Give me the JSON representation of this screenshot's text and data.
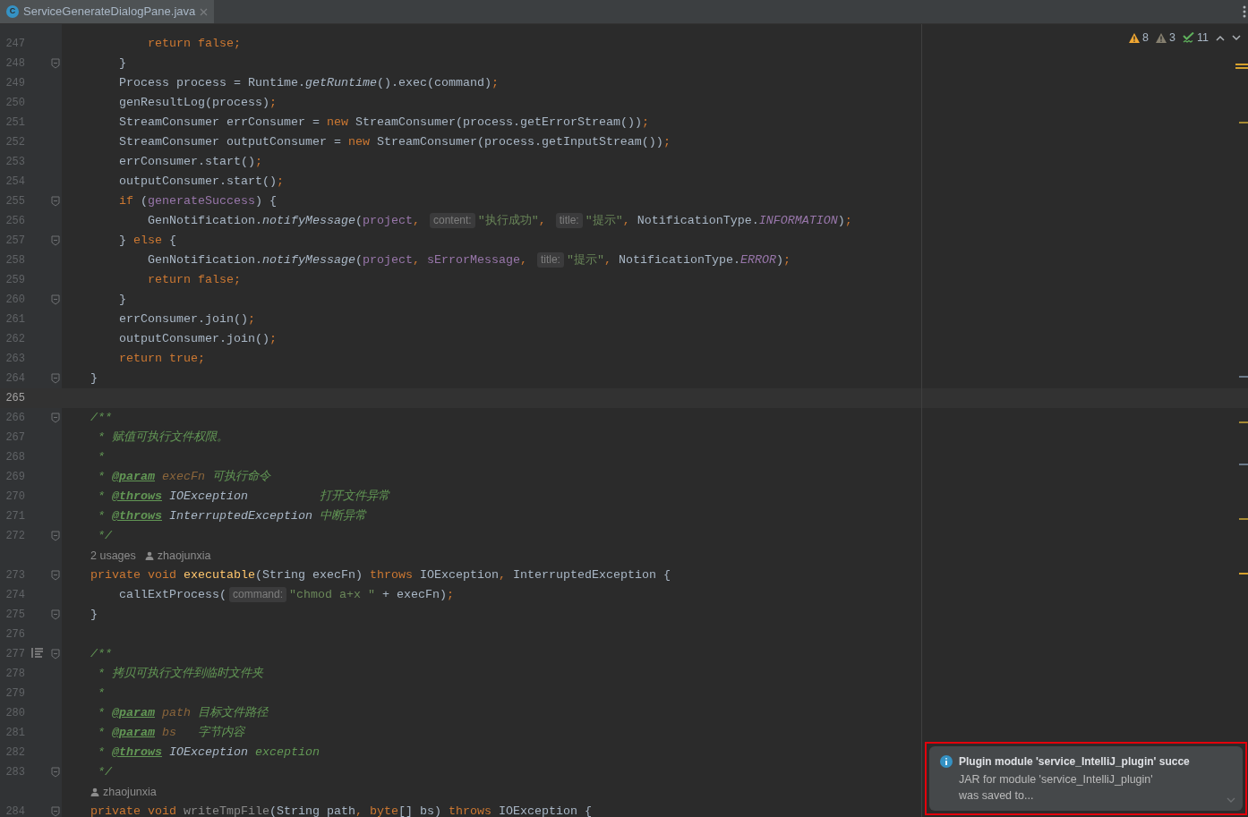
{
  "tab": {
    "title": "ServiceGenerateDialogPane.java",
    "icon": "C",
    "selected": true
  },
  "inspections": [
    {
      "kind": "warning",
      "count": "8"
    },
    {
      "kind": "weak_warning",
      "count": "3"
    },
    {
      "kind": "typo",
      "count": "11"
    }
  ],
  "rows": [
    {
      "kind": "code",
      "number": "247",
      "fold": false,
      "current": false,
      "tokens": [
        {
          "kind": "kw",
          "text": "        return false;"
        }
      ]
    },
    {
      "kind": "code",
      "number": "248",
      "fold": true,
      "current": false,
      "tokens": [
        {
          "kind": "plain",
          "text": "    }"
        }
      ]
    },
    {
      "kind": "code",
      "number": "249",
      "fold": false,
      "current": false,
      "tokens": [
        {
          "kind": "plain",
          "text": "    Process process = Runtime."
        },
        {
          "kind": "italic",
          "text": "getRuntime"
        },
        {
          "kind": "plain",
          "text": "().exec(command)"
        },
        {
          "kind": "kw",
          "text": ";"
        }
      ]
    },
    {
      "kind": "code",
      "number": "250",
      "fold": false,
      "current": false,
      "tokens": [
        {
          "kind": "plain",
          "text": "    genResultLog(process)"
        },
        {
          "kind": "kw",
          "text": ";"
        }
      ]
    },
    {
      "kind": "code",
      "number": "251",
      "fold": false,
      "current": false,
      "tokens": [
        {
          "kind": "plain",
          "text": "    StreamConsumer errConsumer = "
        },
        {
          "kind": "kw",
          "text": "new"
        },
        {
          "kind": "plain",
          "text": " StreamConsumer(process.getErrorStream())"
        },
        {
          "kind": "kw",
          "text": ";"
        }
      ]
    },
    {
      "kind": "code",
      "number": "252",
      "fold": false,
      "current": false,
      "tokens": [
        {
          "kind": "plain",
          "text": "    StreamConsumer outputConsumer = "
        },
        {
          "kind": "kw",
          "text": "new"
        },
        {
          "kind": "plain",
          "text": " StreamConsumer(process.getInputStream())"
        },
        {
          "kind": "kw",
          "text": ";"
        }
      ]
    },
    {
      "kind": "code",
      "number": "253",
      "fold": false,
      "current": false,
      "tokens": [
        {
          "kind": "plain",
          "text": "    errConsumer.start()"
        },
        {
          "kind": "kw",
          "text": ";"
        }
      ]
    },
    {
      "kind": "code",
      "number": "254",
      "fold": false,
      "current": false,
      "tokens": [
        {
          "kind": "plain",
          "text": "    outputConsumer.start()"
        },
        {
          "kind": "kw",
          "text": ";"
        }
      ]
    },
    {
      "kind": "code",
      "number": "255",
      "fold": true,
      "current": false,
      "tokens": [
        {
          "kind": "kw",
          "text": "    if"
        },
        {
          "kind": "plain",
          "text": " ("
        },
        {
          "kind": "field",
          "text": "generateSuccess"
        },
        {
          "kind": "plain",
          "text": ") {"
        }
      ]
    },
    {
      "kind": "code",
      "number": "256",
      "fold": false,
      "current": false,
      "tokens": [
        {
          "kind": "plain",
          "text": "        GenNotification."
        },
        {
          "kind": "italic",
          "text": "notifyMessage"
        },
        {
          "kind": "plain",
          "text": "("
        },
        {
          "kind": "field",
          "text": "project"
        },
        {
          "kind": "kw",
          "text": ", "
        },
        {
          "kind": "hint",
          "text": "content:"
        },
        {
          "kind": "str",
          "text": "\"执行成功\""
        },
        {
          "kind": "kw",
          "text": ", "
        },
        {
          "kind": "hint",
          "text": "title:"
        },
        {
          "kind": "str",
          "text": "\"提示\""
        },
        {
          "kind": "kw",
          "text": ", "
        },
        {
          "kind": "plain",
          "text": "NotificationType."
        },
        {
          "kind": "field_italic",
          "text": "INFORMATION"
        },
        {
          "kind": "plain",
          "text": ")"
        },
        {
          "kind": "kw",
          "text": ";"
        }
      ]
    },
    {
      "kind": "code",
      "number": "257",
      "fold": true,
      "current": false,
      "tokens": [
        {
          "kind": "plain",
          "text": "    } "
        },
        {
          "kind": "kw",
          "text": "else"
        },
        {
          "kind": "plain",
          "text": " {"
        }
      ]
    },
    {
      "kind": "code",
      "number": "258",
      "fold": false,
      "current": false,
      "tokens": [
        {
          "kind": "plain",
          "text": "        GenNotification."
        },
        {
          "kind": "italic",
          "text": "notifyMessage"
        },
        {
          "kind": "plain",
          "text": "("
        },
        {
          "kind": "field",
          "text": "project"
        },
        {
          "kind": "kw",
          "text": ", "
        },
        {
          "kind": "field",
          "text": "sErrorMessage"
        },
        {
          "kind": "kw",
          "text": ", "
        },
        {
          "kind": "hint",
          "text": "title:"
        },
        {
          "kind": "str",
          "text": "\"提示\""
        },
        {
          "kind": "kw",
          "text": ", "
        },
        {
          "kind": "plain",
          "text": "NotificationType."
        },
        {
          "kind": "field_italic",
          "text": "ERROR"
        },
        {
          "kind": "plain",
          "text": ")"
        },
        {
          "kind": "kw",
          "text": ";"
        }
      ]
    },
    {
      "kind": "code",
      "number": "259",
      "fold": false,
      "current": false,
      "tokens": [
        {
          "kind": "kw",
          "text": "        return false;"
        }
      ]
    },
    {
      "kind": "code",
      "number": "260",
      "fold": true,
      "current": false,
      "tokens": [
        {
          "kind": "plain",
          "text": "    }"
        }
      ]
    },
    {
      "kind": "code",
      "number": "261",
      "fold": false,
      "current": false,
      "tokens": [
        {
          "kind": "plain",
          "text": "    errConsumer.join()"
        },
        {
          "kind": "kw",
          "text": ";"
        }
      ]
    },
    {
      "kind": "code",
      "number": "262",
      "fold": false,
      "current": false,
      "tokens": [
        {
          "kind": "plain",
          "text": "    outputConsumer.join()"
        },
        {
          "kind": "kw",
          "text": ";"
        }
      ]
    },
    {
      "kind": "code",
      "number": "263",
      "fold": false,
      "current": false,
      "tokens": [
        {
          "kind": "kw",
          "text": "    return true;"
        }
      ]
    },
    {
      "kind": "code",
      "number": "264",
      "fold": true,
      "current": false,
      "tokens": [
        {
          "kind": "plain",
          "text": "}"
        }
      ]
    },
    {
      "kind": "code",
      "number": "265",
      "fold": false,
      "current": true,
      "tokens": []
    },
    {
      "kind": "code",
      "number": "266",
      "fold": true,
      "current": false,
      "tokens": [
        {
          "kind": "doc",
          "text": "/**"
        }
      ]
    },
    {
      "kind": "code",
      "number": "267",
      "fold": false,
      "current": false,
      "tokens": [
        {
          "kind": "doc",
          "text": " * 赋值可执行文件权限。"
        }
      ]
    },
    {
      "kind": "code",
      "number": "268",
      "fold": false,
      "current": false,
      "tokens": [
        {
          "kind": "doc",
          "text": " *"
        }
      ]
    },
    {
      "kind": "code",
      "number": "269",
      "fold": false,
      "current": false,
      "tokens": [
        {
          "kind": "doc",
          "text": " * "
        },
        {
          "kind": "doctag",
          "text": "@param"
        },
        {
          "kind": "docparam",
          "text": " execFn"
        },
        {
          "kind": "doc",
          "text": " 可执行命令"
        }
      ]
    },
    {
      "kind": "code",
      "number": "270",
      "fold": false,
      "current": false,
      "tokens": [
        {
          "kind": "doc",
          "text": " * "
        },
        {
          "kind": "doctag",
          "text": "@throws"
        },
        {
          "kind": "docref",
          "text": " IOException"
        },
        {
          "kind": "doc",
          "text": "          打开文件异常"
        }
      ]
    },
    {
      "kind": "code",
      "number": "271",
      "fold": false,
      "current": false,
      "tokens": [
        {
          "kind": "doc",
          "text": " * "
        },
        {
          "kind": "doctag",
          "text": "@throws"
        },
        {
          "kind": "docref",
          "text": " InterruptedException"
        },
        {
          "kind": "doc",
          "text": " 中断异常"
        }
      ]
    },
    {
      "kind": "code",
      "number": "272",
      "fold": true,
      "current": false,
      "tokens": [
        {
          "kind": "doc",
          "text": " */"
        }
      ]
    },
    {
      "kind": "lens",
      "items": [
        {
          "kind": "usages",
          "text": "2 usages"
        },
        {
          "kind": "author",
          "text": "zhaojunxia"
        }
      ]
    },
    {
      "kind": "code",
      "number": "273",
      "fold": true,
      "current": false,
      "tokens": [
        {
          "kind": "kw",
          "text": "private void"
        },
        {
          "kind": "decl",
          "text": " executable"
        },
        {
          "kind": "plain",
          "text": "(String execFn) "
        },
        {
          "kind": "kw",
          "text": "throws"
        },
        {
          "kind": "plain",
          "text": " IOException"
        },
        {
          "kind": "kw",
          "text": ", "
        },
        {
          "kind": "plain",
          "text": "InterruptedException {"
        }
      ]
    },
    {
      "kind": "code",
      "number": "274",
      "fold": false,
      "current": false,
      "tokens": [
        {
          "kind": "plain",
          "text": "    callExtProcess("
        },
        {
          "kind": "hint",
          "text": "command:"
        },
        {
          "kind": "str",
          "text": "\"chmod a+x \""
        },
        {
          "kind": "plain",
          "text": " + execFn)"
        },
        {
          "kind": "kw",
          "text": ";"
        }
      ]
    },
    {
      "kind": "code",
      "number": "275",
      "fold": true,
      "current": false,
      "tokens": [
        {
          "kind": "plain",
          "text": "}"
        }
      ]
    },
    {
      "kind": "code",
      "number": "276",
      "fold": false,
      "current": false,
      "tokens": []
    },
    {
      "kind": "code",
      "number": "277",
      "fold": true,
      "current": false,
      "doc_toggle": true,
      "tokens": [
        {
          "kind": "doc",
          "text": "/**"
        }
      ]
    },
    {
      "kind": "code",
      "number": "278",
      "fold": false,
      "current": false,
      "tokens": [
        {
          "kind": "doc",
          "text": " * 拷贝可执行文件到临时文件夹"
        }
      ]
    },
    {
      "kind": "code",
      "number": "279",
      "fold": false,
      "current": false,
      "tokens": [
        {
          "kind": "doc",
          "text": " *"
        }
      ]
    },
    {
      "kind": "code",
      "number": "280",
      "fold": false,
      "current": false,
      "tokens": [
        {
          "kind": "doc",
          "text": " * "
        },
        {
          "kind": "doctag",
          "text": "@param"
        },
        {
          "kind": "docparam",
          "text": " path"
        },
        {
          "kind": "doc",
          "text": " 目标文件路径"
        }
      ]
    },
    {
      "kind": "code",
      "number": "281",
      "fold": false,
      "current": false,
      "tokens": [
        {
          "kind": "doc",
          "text": " * "
        },
        {
          "kind": "doctag",
          "text": "@param"
        },
        {
          "kind": "docparam",
          "text": " bs"
        },
        {
          "kind": "doc",
          "text": "   字节内容"
        }
      ]
    },
    {
      "kind": "code",
      "number": "282",
      "fold": false,
      "current": false,
      "tokens": [
        {
          "kind": "doc",
          "text": " * "
        },
        {
          "kind": "doctag",
          "text": "@throws"
        },
        {
          "kind": "docref",
          "text": " IOException"
        },
        {
          "kind": "doc",
          "text": " exception"
        }
      ]
    },
    {
      "kind": "code",
      "number": "283",
      "fold": true,
      "current": false,
      "tokens": [
        {
          "kind": "doc",
          "text": " */"
        }
      ]
    },
    {
      "kind": "lens",
      "items": [
        {
          "kind": "author",
          "text": "zhaojunxia"
        }
      ]
    },
    {
      "kind": "code",
      "number": "284",
      "fold": true,
      "current": false,
      "tokens": [
        {
          "kind": "kw",
          "text": "private void"
        },
        {
          "kind": "unused",
          "text": " writeTmpFile"
        },
        {
          "kind": "plain",
          "text": "(String path"
        },
        {
          "kind": "kw",
          "text": ", byte"
        },
        {
          "kind": "plain",
          "text": "[] bs) "
        },
        {
          "kind": "kw",
          "text": "throws"
        },
        {
          "kind": "plain",
          "text": " IOException {"
        }
      ]
    }
  ],
  "notification": {
    "title": "Plugin module 'service_IntelliJ_plugin' succe",
    "body": "JAR for module 'service_IntelliJ_plugin' was saved to..."
  }
}
